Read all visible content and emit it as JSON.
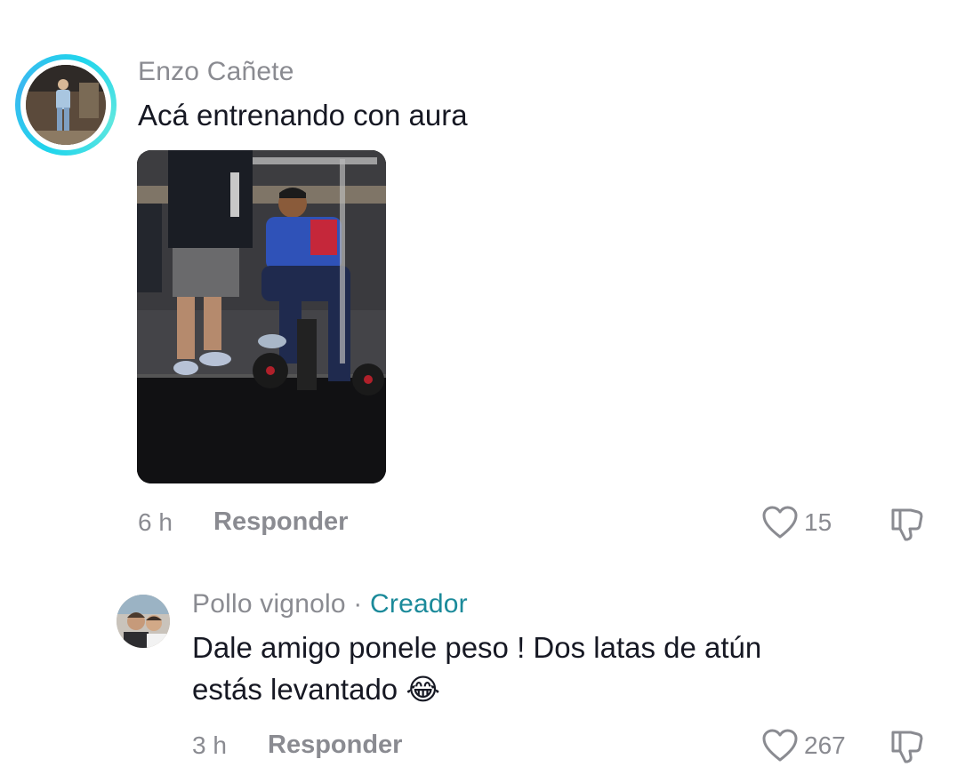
{
  "comment1": {
    "username": "Enzo Cañete",
    "text": "Acá entrenando con aura",
    "time": "6 h",
    "reply_label": "Responder",
    "likes": "15"
  },
  "comment2": {
    "username": "Pollo vignolo",
    "separator": "·",
    "badge": "Creador",
    "text_line1": "Dale amigo ponele peso ! Dos latas de atún",
    "text_line2": "estás levantado",
    "emoji": "😂",
    "time": "3 h",
    "reply_label": "Responder",
    "likes": "267"
  },
  "icons": {
    "like": "heart-outline-icon",
    "dislike": "thumbs-down-icon"
  },
  "colors": {
    "story_ring": "#20d5ec",
    "creator_badge": "#1b8a9a",
    "muted_text": "#8a8b91"
  }
}
